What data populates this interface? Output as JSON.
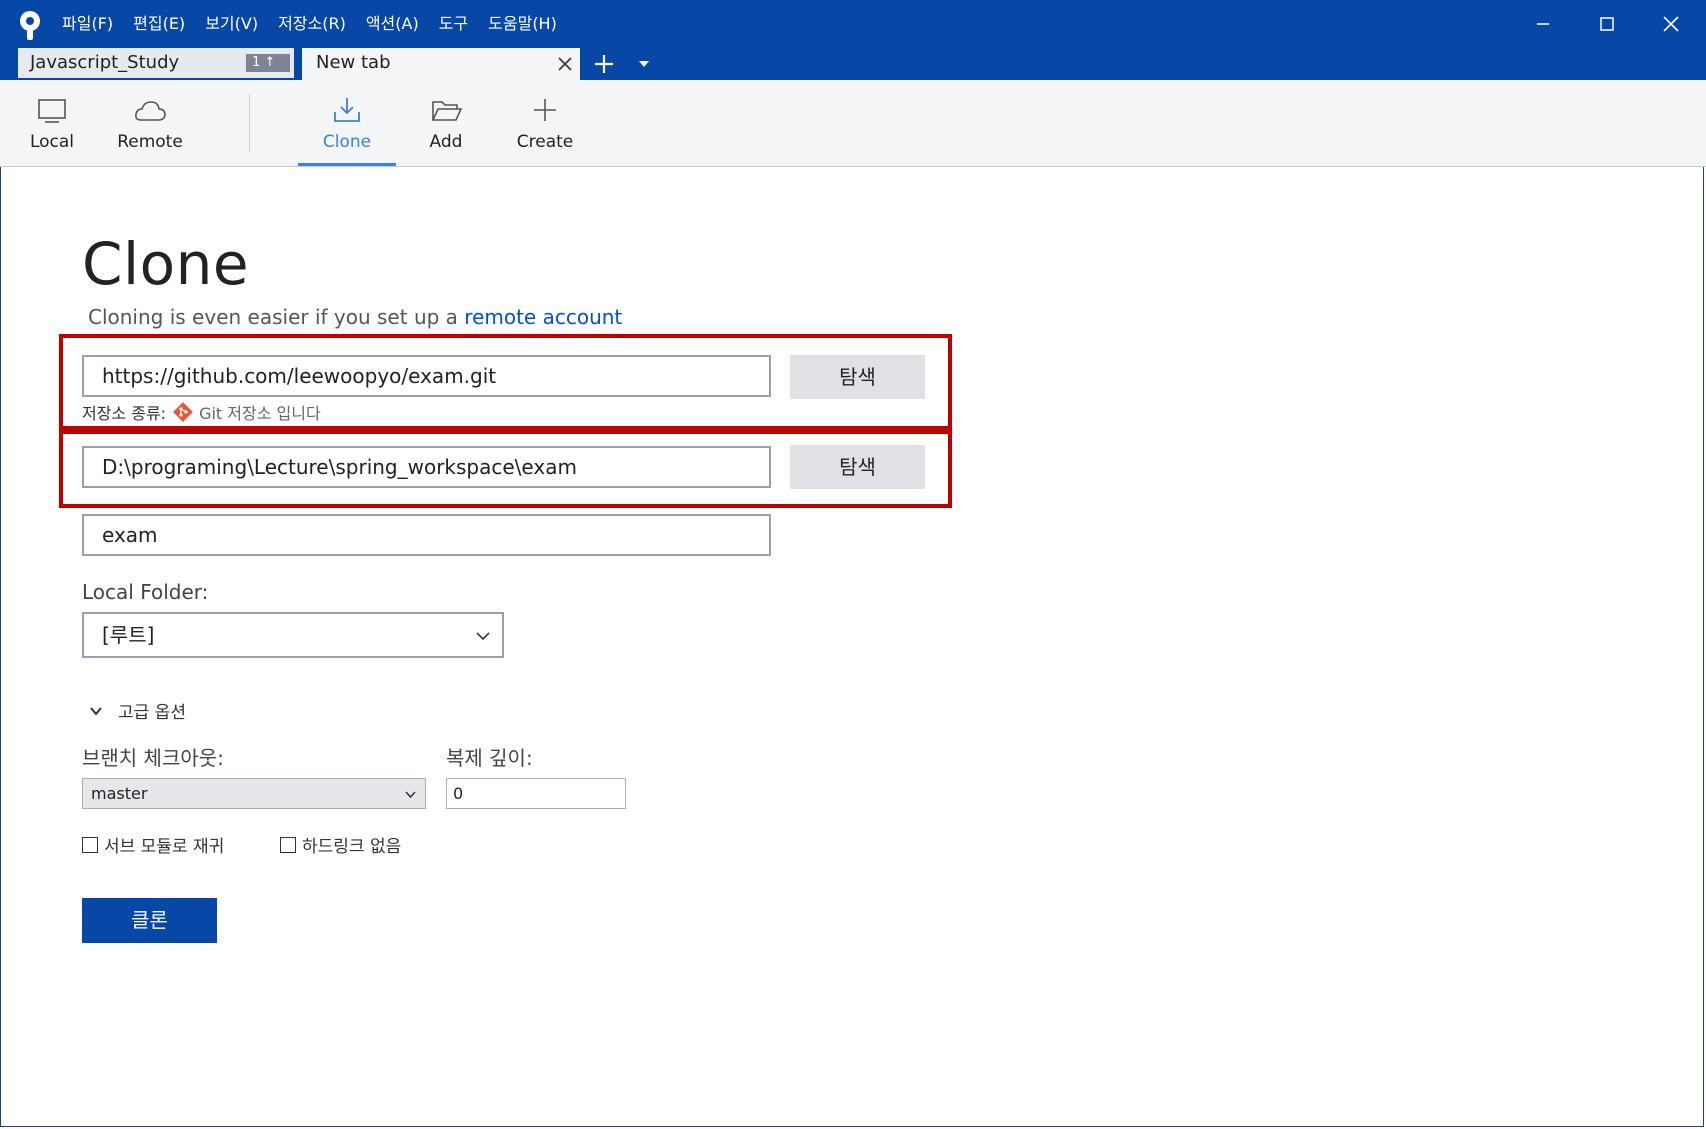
{
  "menu": [
    "파일(F)",
    "편집(E)",
    "보기(V)",
    "저장소(R)",
    "액션(A)",
    "도구",
    "도움말(H)"
  ],
  "tabs": [
    {
      "label": "Javascript_Study",
      "badge": "1 ↑"
    },
    {
      "label": "New tab"
    }
  ],
  "toolbar": {
    "local": "Local",
    "remote": "Remote",
    "clone": "Clone",
    "add": "Add",
    "create": "Create"
  },
  "clone": {
    "title": "Clone",
    "subtitle_prefix": "Cloning is even easier if you set up a ",
    "subtitle_link": "remote account",
    "source_url": "https://github.com/leewoopyo/exam.git",
    "browse_label": "탐색",
    "repo_type_label": "저장소 종류:",
    "repo_type_value": "Git 저장소 입니다",
    "destination_path": "D:\\programing\\Lecture\\spring_workspace\\exam",
    "name": "exam",
    "local_folder_label": "Local Folder:",
    "local_folder_value": "[루트]",
    "advanced_label": "고급 옵션",
    "branch_label": "브랜치 체크아웃:",
    "branch_value": "master",
    "depth_label": "복제 깊이:",
    "depth_value": "0",
    "recurse_submodules_label": "서브 모듈로 재귀",
    "no_hardlinks_label": "하드링크 없음",
    "clone_button": "클론"
  },
  "colors": {
    "titlebar": "#0747a6",
    "accent": "#3b83d6",
    "link": "#0052cc",
    "highlight": "#c00000"
  }
}
